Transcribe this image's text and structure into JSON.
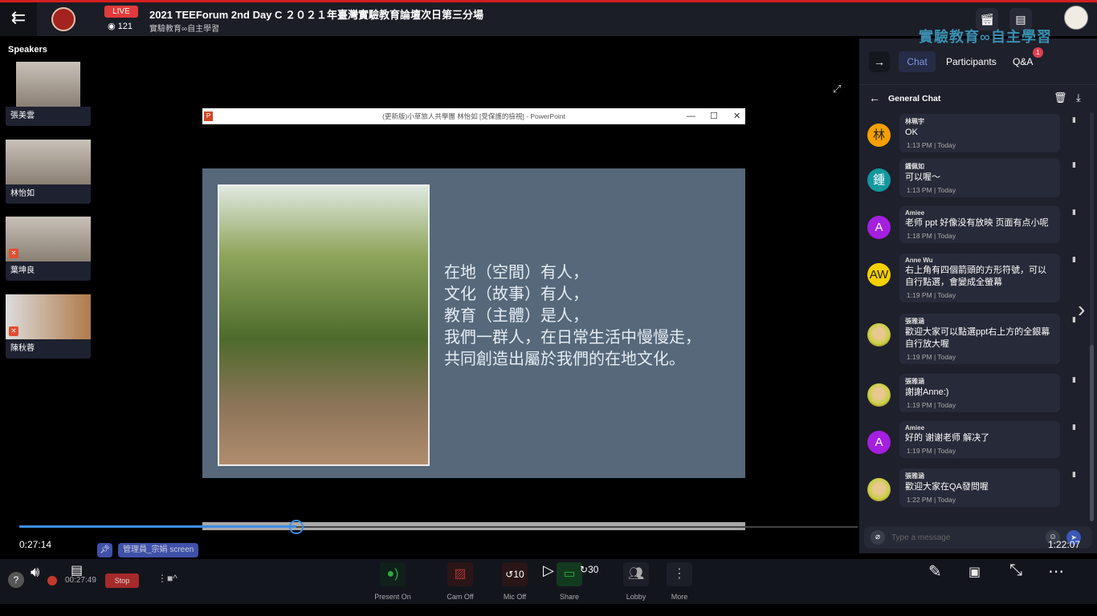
{
  "header": {
    "live_label": "LIVE",
    "viewer_count": "121",
    "title": "2021 TEEForum 2nd Day C ２０２１年臺灣實驗教育論壇次日第三分場",
    "subtitle": "實驗教育∞自主學習"
  },
  "speakers": {
    "label": "Speakers",
    "items": [
      {
        "name": "張美雲",
        "muted": false
      },
      {
        "name": "林怡如",
        "muted": false
      },
      {
        "name": "葉坤良",
        "muted": true
      },
      {
        "name": "陳秋蓉",
        "muted": true
      }
    ]
  },
  "ppt": {
    "window_title": "(更新版)小草旅人共學團 林怡如 [受保護的檢視] - PowerPoint",
    "slide_lines": [
      "在地（空間）有人，",
      "文化（故事）有人，",
      "教育（主體）是人，",
      "我們一群人，在日常生活中慢慢走，",
      "共同創造出屬於我們的在地文化。"
    ]
  },
  "playback": {
    "current_time": "0:27:14",
    "total_time": "1:22:07",
    "progress_percent": 33
  },
  "screen_chip": "管理員_宗娟 screen",
  "toolbar": {
    "record_time": "00:27:49",
    "stop_label": "Stop",
    "present_label": "Present On",
    "cam_label": "Cam Off",
    "mic_label": "Mic Off",
    "share_label": "Share",
    "lobby_label": "Lobby",
    "more_label": "More",
    "rewind_label": "10",
    "forward_label": "30"
  },
  "panel": {
    "logo_text": "實驗教育∞自主學習",
    "tabs": {
      "chat": "Chat",
      "participants": "Participants",
      "qa": "Q&A",
      "qa_badge": "1"
    },
    "general_chat": "General Chat",
    "input_placeholder": "Type a message",
    "messages": [
      {
        "sender": "林珮宇",
        "avatar": "林",
        "color": "#f5a000",
        "text": "OK",
        "time": "1:13 PM | Today"
      },
      {
        "sender": "鍾佩如",
        "avatar": "鍾",
        "color": "#13979f",
        "text": "可以喔～",
        "time": "1:13 PM | Today"
      },
      {
        "sender": "Amiee",
        "avatar": "A",
        "color": "#a51fe0",
        "text": " 老师 ppt 好像没有放映 页面有点小呢",
        "time": "1:18 PM | Today"
      },
      {
        "sender": "Anne Wu",
        "avatar": "AW",
        "color": "#f7d000",
        "text": "右上角有四個箭頭的方形符號，可以自行點選，會變成全螢幕",
        "time": "1:19 PM | Today"
      },
      {
        "sender": "張雅涵",
        "avatar": "",
        "color": "#c9a040",
        "text": "歡迎大家可以點選ppt右上方的全銀幕自行放大喔",
        "time": "1:19 PM | Today"
      },
      {
        "sender": "張雅涵",
        "avatar": "",
        "color": "#c9a040",
        "text": "謝謝Anne:)",
        "time": "1:19 PM | Today"
      },
      {
        "sender": "Amiee",
        "avatar": "A",
        "color": "#a51fe0",
        "text": "好的  谢谢老师  解决了",
        "time": "1:19 PM | Today"
      },
      {
        "sender": "張雅涵",
        "avatar": "",
        "color": "#c9a040",
        "text": "歡迎大家在QA發問喔",
        "time": "1:22 PM | Today"
      }
    ]
  }
}
